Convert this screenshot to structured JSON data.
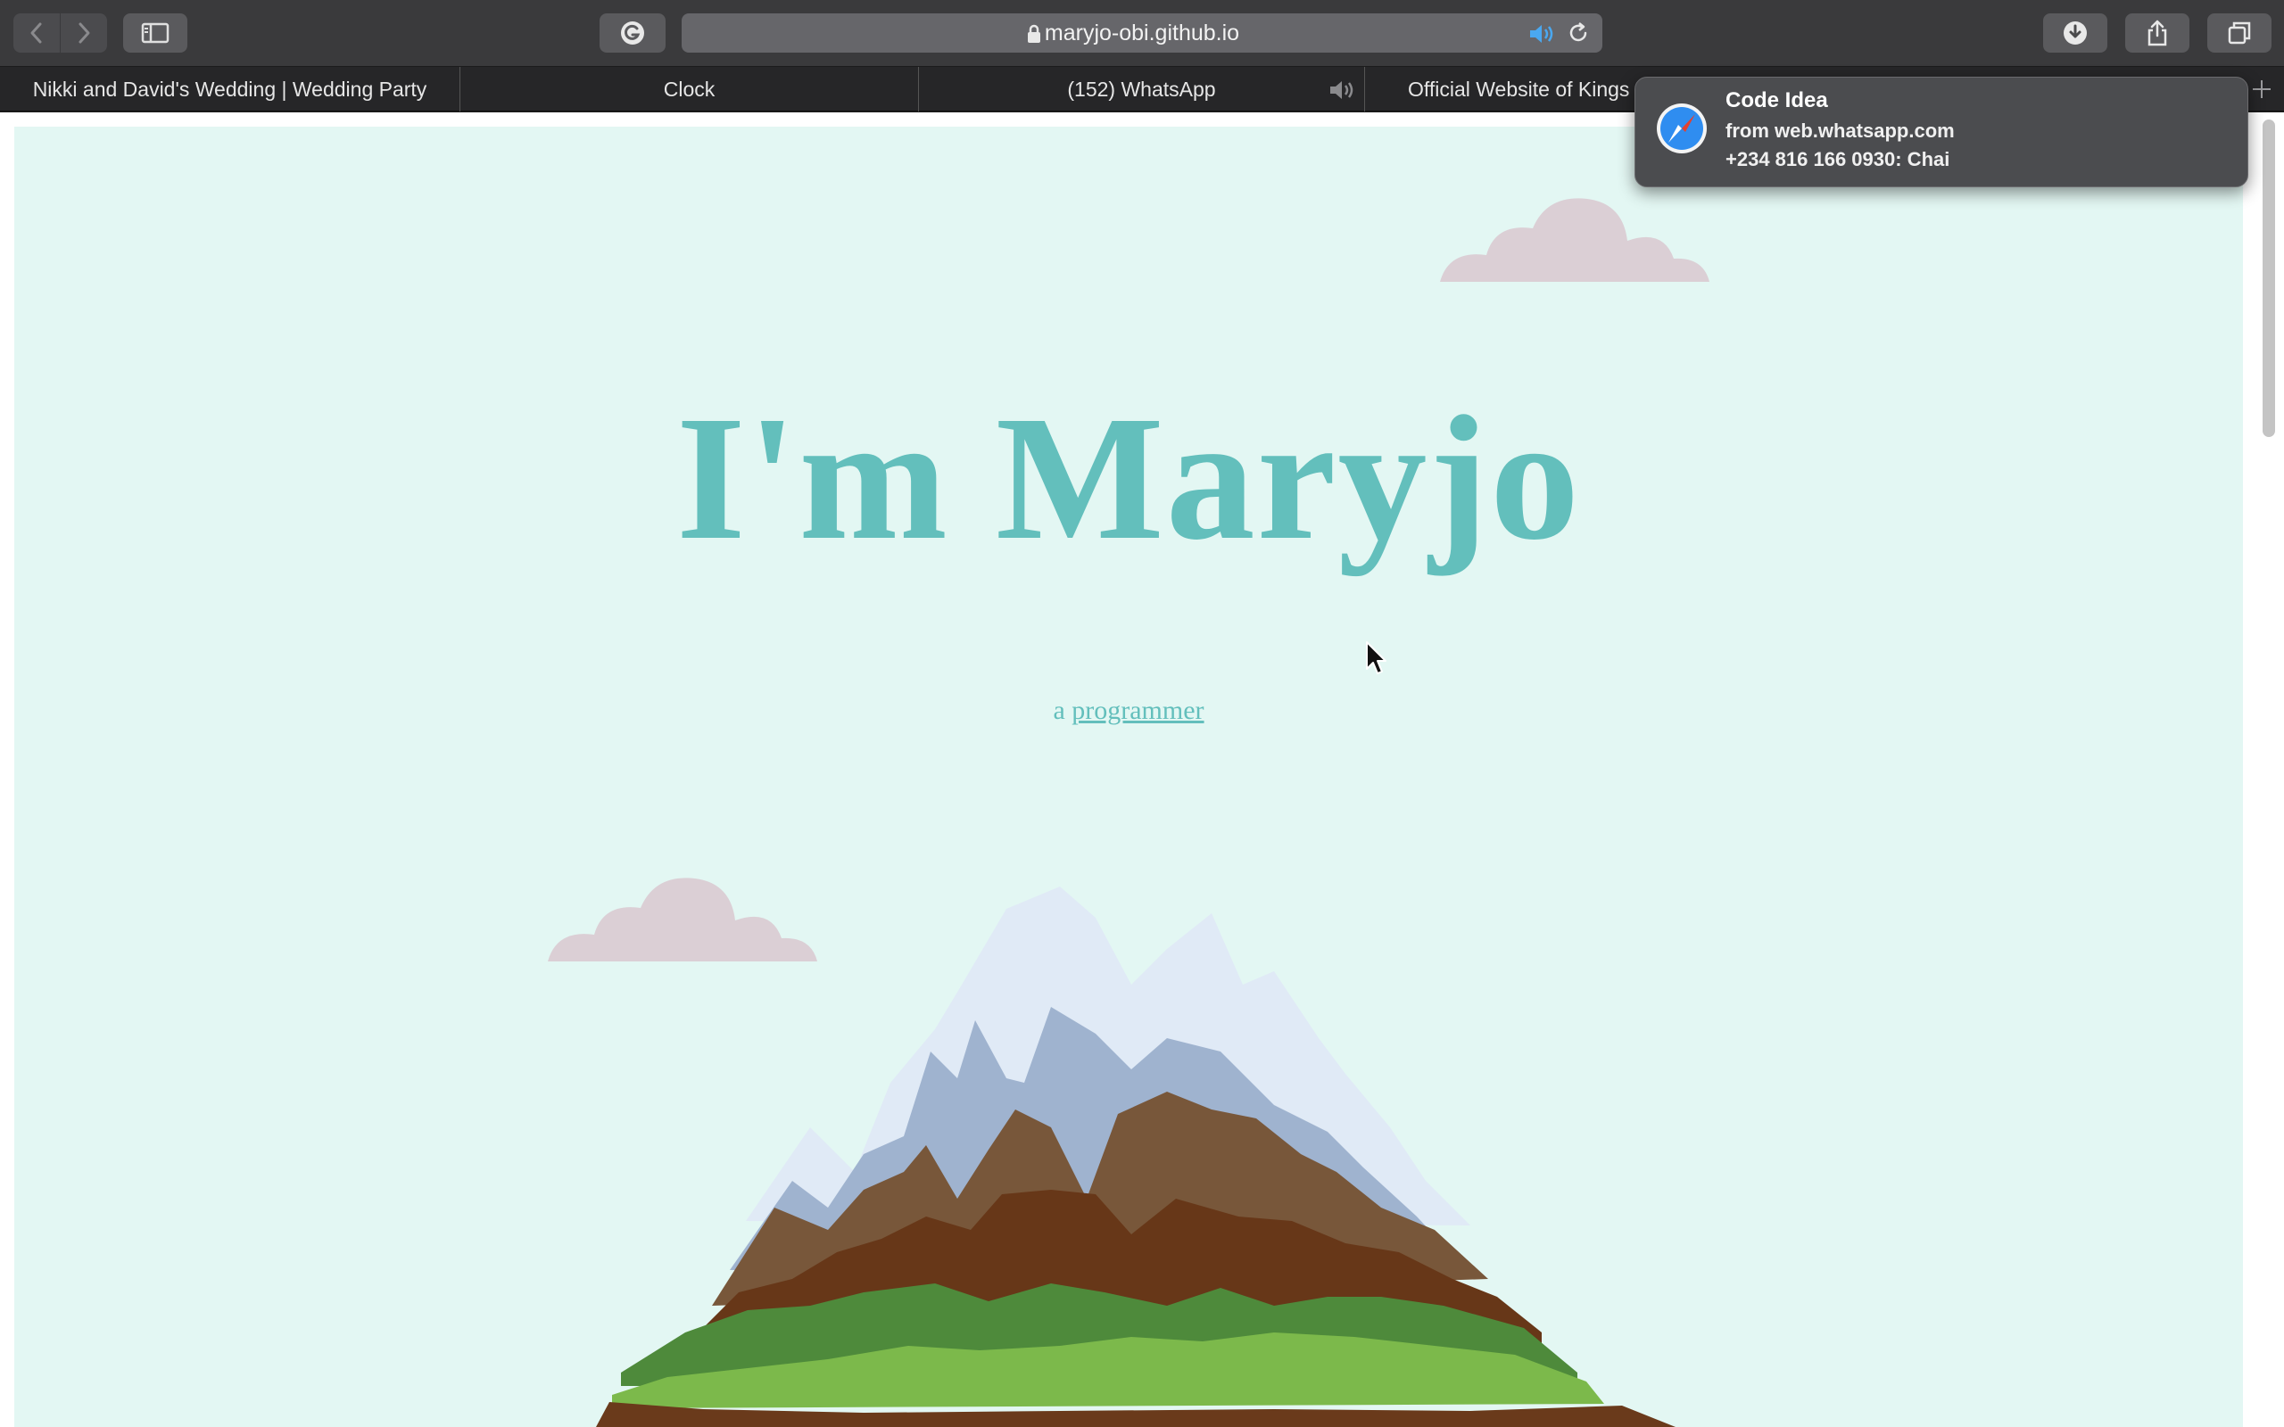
{
  "browser": {
    "address": {
      "url": "maryjo-obi.github.io"
    },
    "tabs": [
      {
        "title": "Nikki and David's Wedding | Wedding Party"
      },
      {
        "title": "Clock"
      },
      {
        "title": "(152) WhatsApp"
      },
      {
        "title": "Official Website of Kings"
      }
    ],
    "icons": {
      "back": "chevron-left-icon",
      "forward": "chevron-right-icon",
      "sidebar": "sidebar-icon",
      "extension": "grammarly-icon",
      "lock": "lock-icon",
      "audio": "speaker-icon",
      "reload": "reload-icon",
      "download": "download-icon",
      "share": "share-icon",
      "tabs_overview": "tabs-overview-icon",
      "new_tab": "plus-icon"
    }
  },
  "page": {
    "title": "I'm Maryjo",
    "subtitle_prefix": "a",
    "subtitle_link": "programmer",
    "colors": {
      "background": "#e3f7f3",
      "accent": "#63bfbc",
      "cloud": "#dbcfd5"
    }
  },
  "notification": {
    "title": "Code Idea",
    "source": "from web.whatsapp.com",
    "body": "+234 816 166 0930: Chai",
    "icon": "safari-compass-icon"
  }
}
